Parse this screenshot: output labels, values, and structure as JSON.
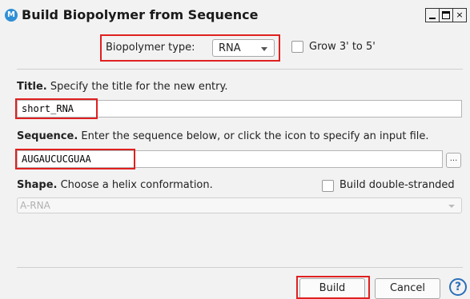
{
  "window": {
    "title": "Build Biopolymer from Sequence",
    "icon_letter": "M",
    "controls": {
      "minimize": "",
      "maximize": "",
      "close": "×"
    }
  },
  "biopolymer_type": {
    "label": "Biopolymer type:",
    "value": "RNA"
  },
  "grow": {
    "label": "Grow 3' to 5'",
    "checked": false
  },
  "title_section": {
    "heading": "Title.",
    "description": "Specify the title for the new entry.",
    "value": "short_RNA"
  },
  "sequence_section": {
    "heading": "Sequence.",
    "description": "Enter the sequence below, or click the icon to specify an input file.",
    "value": "AUGAUCUCGUAA",
    "browse_label": "..."
  },
  "shape_section": {
    "heading": "Shape.",
    "description": "Choose a helix conformation.",
    "double_stranded_label": "Build double-stranded",
    "double_stranded_checked": false,
    "value": "A-RNA"
  },
  "buttons": {
    "build": "Build",
    "cancel": "Cancel",
    "help": "?"
  },
  "colors": {
    "highlight": "#e02020",
    "help": "#2a6fb8",
    "app_icon": "#2f8fd6"
  }
}
